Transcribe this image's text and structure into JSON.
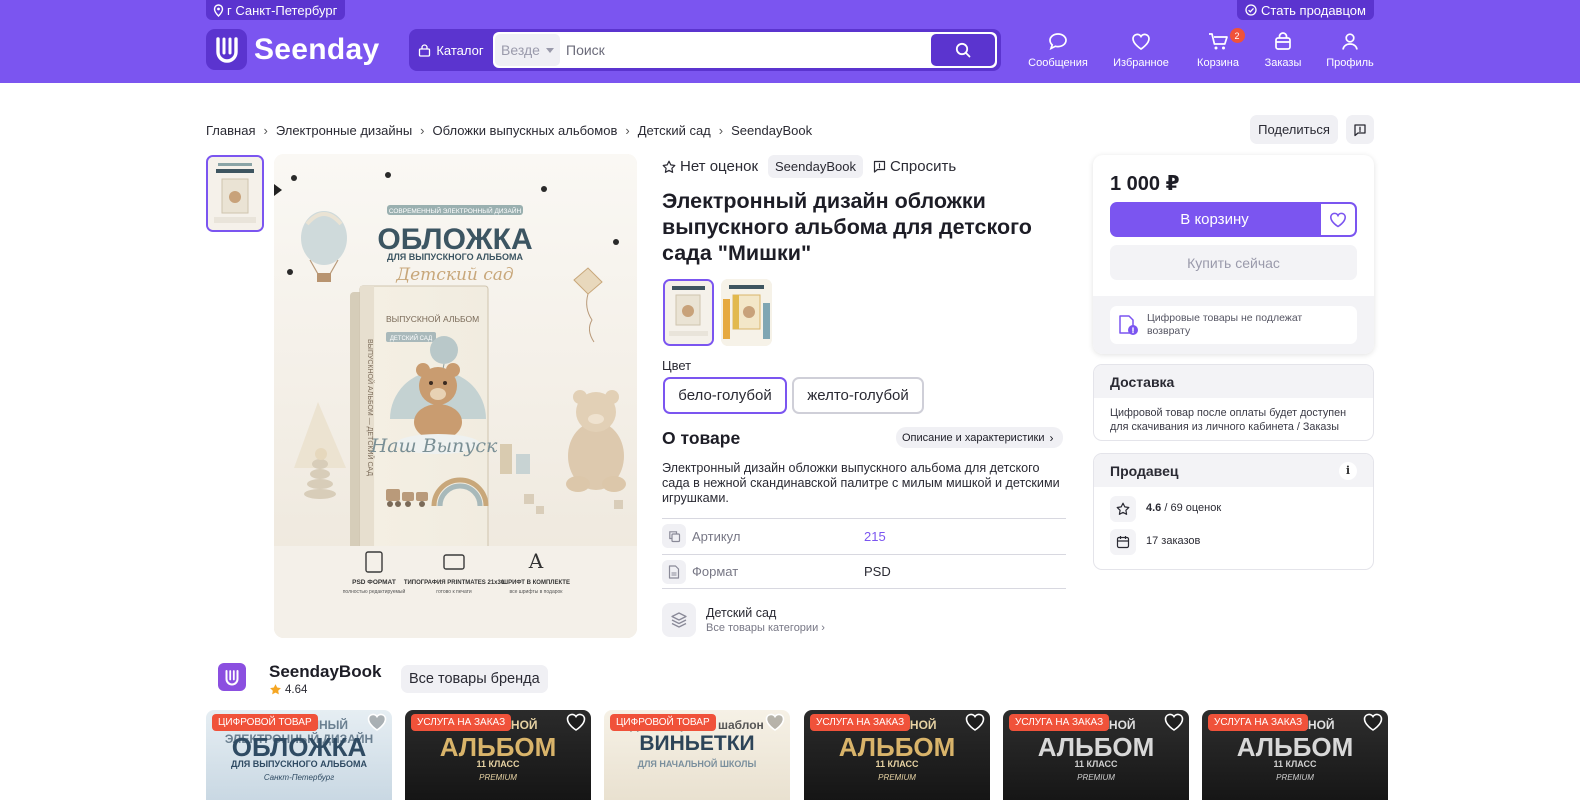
{
  "header": {
    "city": "г Санкт-Петербург",
    "become_seller": "Стать продавцом",
    "logo_text": "Seenday",
    "catalog": "Каталог",
    "scope": "Везде",
    "search_placeholder": "Поиск",
    "nav": [
      {
        "label": "Сообщения",
        "icon": "chat-icon"
      },
      {
        "label": "Избранное",
        "icon": "heart-icon"
      },
      {
        "label": "Корзина",
        "icon": "cart-icon",
        "badge": "2"
      },
      {
        "label": "Заказы",
        "icon": "bag-icon"
      },
      {
        "label": "Профиль",
        "icon": "user-icon"
      }
    ],
    "colors": {
      "bar": "#7b55f0",
      "dark": "#5b34cf",
      "badge": "#f0523a"
    }
  },
  "breadcrumbs": [
    "Главная",
    "Электронные дизайны",
    "Обложки выпускных альбомов",
    "Детский сад",
    "SeendayBook"
  ],
  "share": "Поделиться",
  "product": {
    "rating_text": "Нет оценок",
    "brand": "SeendayBook",
    "ask": "Спросить",
    "title": "Электронный дизайн обложки выпускного альбома для детского сада \"Мишки\"",
    "cover_image": {
      "badge": "СОВРЕМЕННЫЙ ЭЛЕКТРОННЫЙ ДИЗАЙН",
      "heading": "ОБЛОЖКА",
      "subheading": "ДЛЯ ВЫПУСКНОГО АЛЬБОМА",
      "script": "Детский сад",
      "book_title": "ВЫПУСКНОЙ АЛЬБОМ",
      "book_sub": "ДЕТСКИЙ САД",
      "book_spine": "ВЫПУСКНОЙ АЛЬБОМ — ДЕТСКИЙ САД",
      "book_script": "Наш Выпуск",
      "features": [
        {
          "title": "PSD ФОРМАТ",
          "sub": "полностью редактируемый"
        },
        {
          "title": "ТИПОГРАФИЯ PRINTMATES 21x30",
          "sub": "готово к печати"
        },
        {
          "title": "ШРИФТ В КОМПЛЕКТЕ",
          "sub": "все шрифты в подарок"
        }
      ]
    },
    "color_label": "Цвет",
    "colors": [
      "бело-голубой",
      "желто-голубой"
    ],
    "about_title": "О товаре",
    "about_link": "Описание и характеристики",
    "description": "Электронный дизайн обложки выпускного альбома для детского сада в нежной скандинавской палитре с милым мишкой и детскими игрушками.",
    "specs": [
      {
        "key": "Артикул",
        "value": "215",
        "icon": "copy-icon"
      },
      {
        "key": "Формат",
        "value": "PSD",
        "icon": "file-icon"
      }
    ],
    "category": {
      "name": "Детский сад",
      "all": "Все товары категории"
    }
  },
  "buy": {
    "price": "1 000 ₽",
    "add_to_cart": "В корзину",
    "buy_now": "Купить сейчас",
    "notice": "Цифровые товары не подлежат возврату"
  },
  "delivery": {
    "title": "Доставка",
    "text": "Цифровой товар после оплаты будет доступен для скачивания из личного кабинета / Заказы"
  },
  "seller": {
    "title": "Продавец",
    "rating": "4.6",
    "reviews": "/ 69 оценок",
    "orders": "17 заказов"
  },
  "brand_strip": {
    "name": "SeendayBook",
    "rating": "4.64",
    "all": "Все товары бренда"
  },
  "cards": [
    {
      "badge": "ЦИФРОВОЙ ТОВАР",
      "top": "СОВРЕМЕННЫЙ ЭЛЕКТРОННЫЙ ДИЗАЙН",
      "big": "ОБЛОЖКА",
      "sub": "ДЛЯ ВЫПУСКНОГО АЛЬБОМА",
      "script": "Санкт-Петербург",
      "theme": "light-blue"
    },
    {
      "badge": "УСЛУГА НА ЗАКАЗ",
      "top": "ВЫПУСКНОЙ",
      "big": "АЛЬБОМ",
      "sub": "11 КЛАСС",
      "script": "PREMIUM",
      "theme": "dark-gold"
    },
    {
      "badge": "ЦИФРОВОЙ ТОВАР",
      "top": "Дизайнерский шаблон",
      "big": "ВИНЬЕТКИ",
      "sub": "ДЛЯ НАЧАЛЬНОЙ ШКОЛЫ",
      "script": "",
      "theme": "light-beige"
    },
    {
      "badge": "УСЛУГА НА ЗАКАЗ",
      "top": "ВЫПУСКНОЙ",
      "big": "АЛЬБОМ",
      "sub": "11 КЛАСС",
      "script": "PREMIUM",
      "theme": "dark-gold"
    },
    {
      "badge": "УСЛУГА НА ЗАКАЗ",
      "top": "ВЫПУСКНОЙ",
      "big": "АЛЬБОМ",
      "sub": "11 КЛАСС",
      "script": "PREMIUM",
      "theme": "dark-silver"
    },
    {
      "badge": "УСЛУГА НА ЗАКАЗ",
      "top": "ВЫПУСКНОЙ",
      "big": "АЛЬБОМ",
      "sub": "11 КЛАСС",
      "script": "PREMIUM",
      "theme": "dark-silver"
    }
  ]
}
